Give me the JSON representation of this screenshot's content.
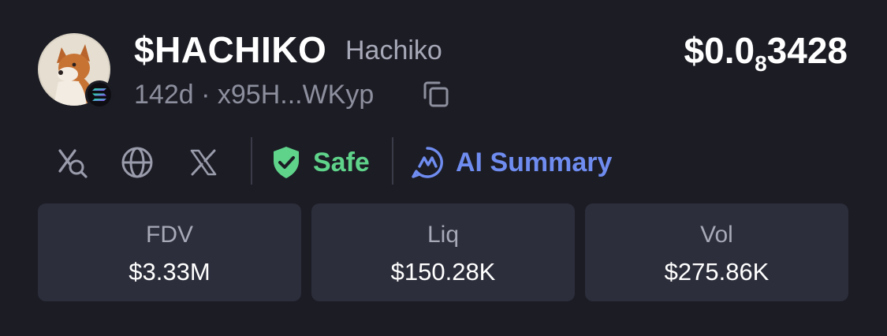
{
  "token": {
    "ticker": "$HACHIKO",
    "name": "Hachiko",
    "age": "142d",
    "address": "x95H...WKyp",
    "avatar_icon": "shiba-dog-avatar",
    "chain_icon": "solana-icon"
  },
  "price": {
    "prefix": "$0.0",
    "zero_count": "8",
    "digits": "3428"
  },
  "actions": {
    "search_x_icon": "search-x-icon",
    "website_icon": "globe-icon",
    "twitter_icon": "x-logo-icon",
    "safe_label": "Safe",
    "ai_summary_label": "AI Summary"
  },
  "stats": [
    {
      "label": "FDV",
      "value": "$3.33M"
    },
    {
      "label": "Liq",
      "value": "$150.28K"
    },
    {
      "label": "Vol",
      "value": "$275.86K"
    }
  ],
  "colors": {
    "background": "#1b1c24",
    "card": "#2c2e3b",
    "safe": "#5fd38a",
    "ai_accent": "#6f8cf0",
    "muted": "#8e8f9e"
  }
}
